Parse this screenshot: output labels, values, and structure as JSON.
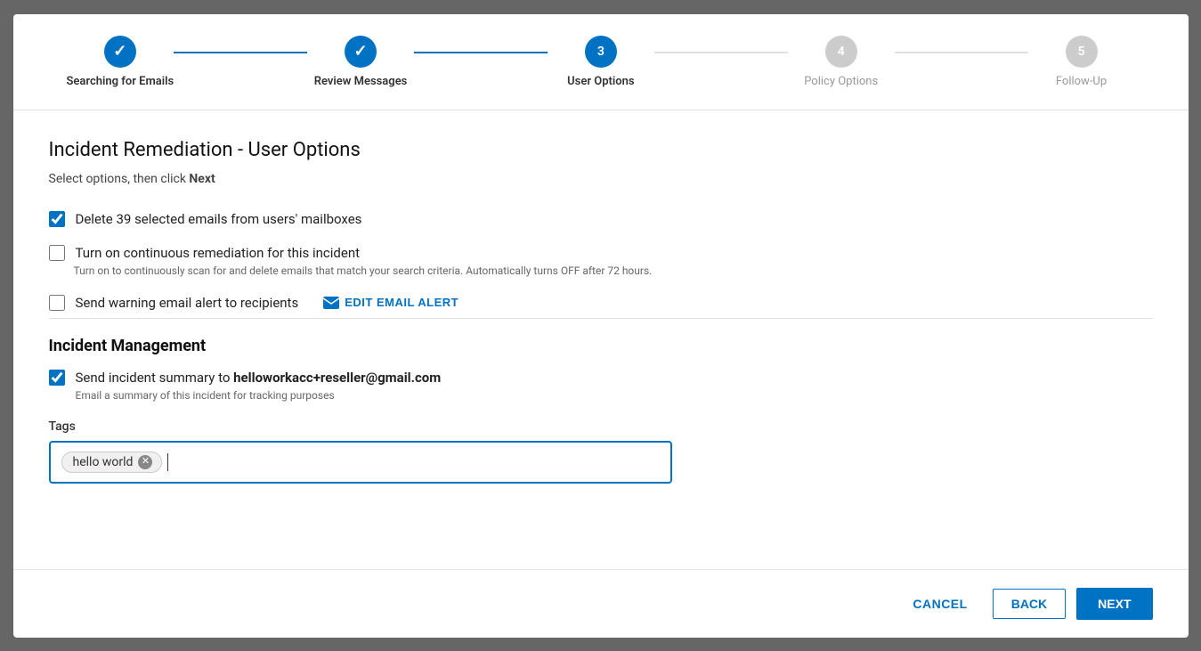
{
  "stepper": {
    "steps": [
      {
        "id": "searching",
        "label": "Searching for Emails",
        "state": "completed",
        "number": "1"
      },
      {
        "id": "review",
        "label": "Review Messages",
        "state": "completed",
        "number": "2"
      },
      {
        "id": "user_options",
        "label": "User Options",
        "state": "active",
        "number": "3"
      },
      {
        "id": "policy",
        "label": "Policy Options",
        "state": "inactive",
        "number": "4"
      },
      {
        "id": "followup",
        "label": "Follow-Up",
        "state": "inactive",
        "number": "5"
      }
    ]
  },
  "page": {
    "title": "Incident Remediation - User Options",
    "subtitle_prefix": "Select options, then click ",
    "subtitle_bold": "Next"
  },
  "options": {
    "delete_checkbox_checked": true,
    "delete_label": "Delete 39 selected emails from users' mailboxes",
    "continuous_checked": false,
    "continuous_label": "Turn on continuous remediation for this incident",
    "continuous_sub": "Turn on to continuously scan for and delete emails that match your search criteria. Automatically turns OFF after 72 hours.",
    "warning_checked": false,
    "warning_label": "Send warning email alert to recipients",
    "edit_email_label": "EDIT EMAIL ALERT"
  },
  "incident_management": {
    "section_title": "Incident Management",
    "summary_checked": true,
    "summary_prefix": "Send incident summary to ",
    "summary_email": "helloworkacc+reseller@gmail.com",
    "summary_sub": "Email a summary of this incident for tracking purposes"
  },
  "tags": {
    "label": "Tags",
    "chips": [
      {
        "id": "tag1",
        "text": "hello world"
      }
    ],
    "placeholder": ""
  },
  "footer": {
    "cancel_label": "CANCEL",
    "back_label": "BACK",
    "next_label": "NEXT"
  },
  "colors": {
    "primary": "#0072c3",
    "inactive": "#ccc"
  }
}
